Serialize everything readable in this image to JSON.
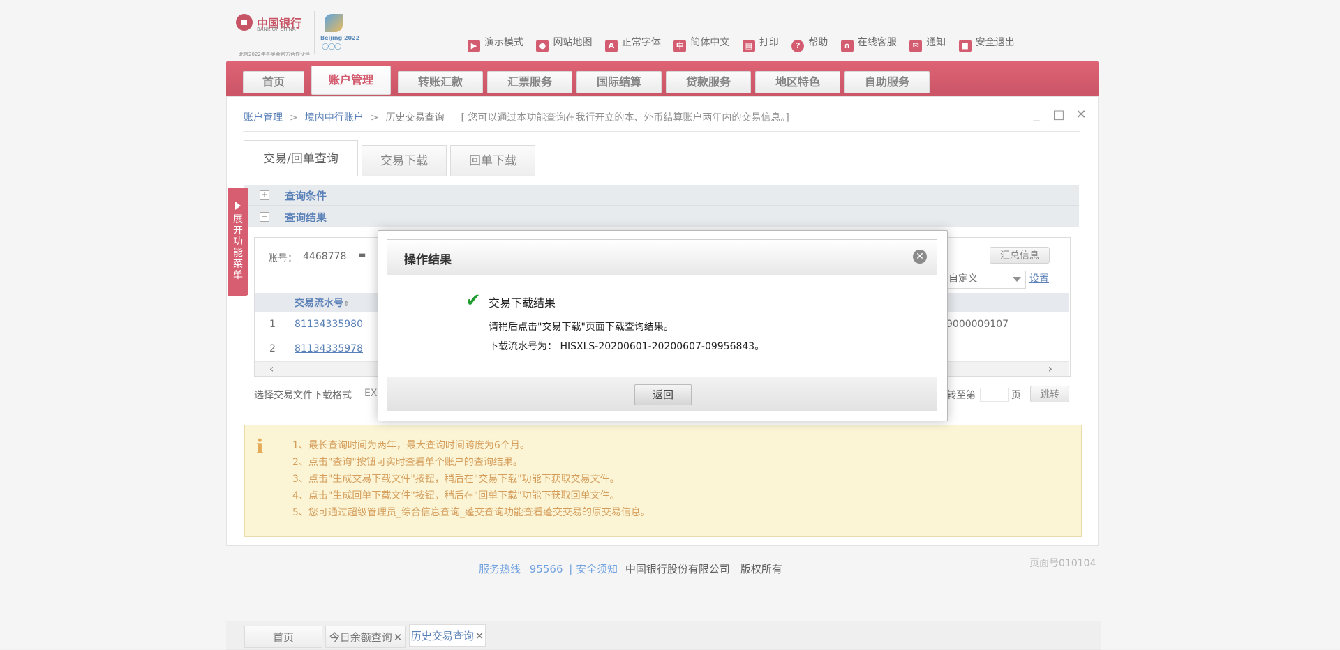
{
  "brand": {
    "bank_name_cn": "中国银行",
    "bank_name_en": "BANK OF CHINA",
    "olympic_text": "Beijing 2022",
    "sponsor_tag": "北京2022年冬奥会官方合作伙伴"
  },
  "toolbar": {
    "items": [
      {
        "label": "演示模式",
        "icon": "demo-icon"
      },
      {
        "label": "网站地图",
        "icon": "map-pin-icon"
      },
      {
        "label": "正常字体",
        "icon": "font-icon"
      },
      {
        "label": "简体中文",
        "icon": "language-icon"
      },
      {
        "label": "打印",
        "icon": "printer-icon"
      },
      {
        "label": "帮助",
        "icon": "help-icon"
      },
      {
        "label": "在线客服",
        "icon": "headset-icon"
      },
      {
        "label": "通知",
        "icon": "mail-icon"
      },
      {
        "label": "安全退出",
        "icon": "lock-icon"
      }
    ]
  },
  "nav": {
    "tabs": [
      "首页",
      "账户管理",
      "转账汇款",
      "汇票服务",
      "国际结算",
      "贷款服务",
      "地区特色",
      "自助服务"
    ],
    "active": "账户管理"
  },
  "breadcrumb": {
    "items": [
      "账户管理",
      "境内中行账户",
      "历史交易查询"
    ],
    "separator": ">",
    "note": "[ 您可以通过本功能查询在我行开立的本、外币结算账户两年内的交易信息。]"
  },
  "sub_tabs": [
    "交易/回单查询",
    "交易下载",
    "回单下载"
  ],
  "side_menu": {
    "label": "展开功能菜单"
  },
  "sections": {
    "query_conditions": "查询条件",
    "query_results": "查询结果"
  },
  "results": {
    "account_label": "账号：",
    "account_value": "4468778",
    "summary_button": "汇总信息",
    "custom_select": "自定义",
    "settings_link": "设置",
    "column_header": "交易流水号",
    "rows": [
      {
        "index": "1",
        "serial": "81134335980",
        "tail": "9000009107"
      },
      {
        "index": "2",
        "serial": "81134335978",
        "tail": ""
      }
    ],
    "download_format_label": "选择交易文件下载格式",
    "download_format_value": "EX",
    "jump_label": "转至第",
    "page_suffix": "页",
    "jump_button": "跳转"
  },
  "tips": [
    "1、最长查询时间为两年，最大查询时间跨度为6个月。",
    "2、点击\"查询\"按钮可实时查看单个账户的查询结果。",
    "3、点击\"生成交易下载文件\"按钮，稍后在\"交易下载\"功能下获取交易文件。",
    "4、点击\"生成回单下载文件\"按钮，稍后在\"回单下载\"功能下获取回单文件。",
    "5、您可通过超级管理员_综合信息查询_蓬交查询功能查看蓬交交易的原交易信息。"
  ],
  "footer": {
    "hotline_label": "服务热线",
    "hotline": "95566",
    "security_link": "| 安全须知",
    "copyright": "中国银行股份有限公司　版权所有",
    "page_number": "页面号010104"
  },
  "taskbar": {
    "tabs": [
      "首页",
      "今日余额查询",
      "历史交易查询"
    ],
    "active": "历史交易查询"
  },
  "dialog": {
    "title": "操作结果",
    "message_title": "交易下载结果",
    "line1": "请稍后点击\"交易下载\"页面下载查询结果。",
    "line2": "下载流水号为： HISXLS-20200601-20200607-09956843。",
    "button": "返回"
  },
  "colors": {
    "brand_red": "#c8203a",
    "link_blue": "#1a4f9c",
    "tip_text": "#c5781c",
    "success_green": "#1f9c2e"
  }
}
